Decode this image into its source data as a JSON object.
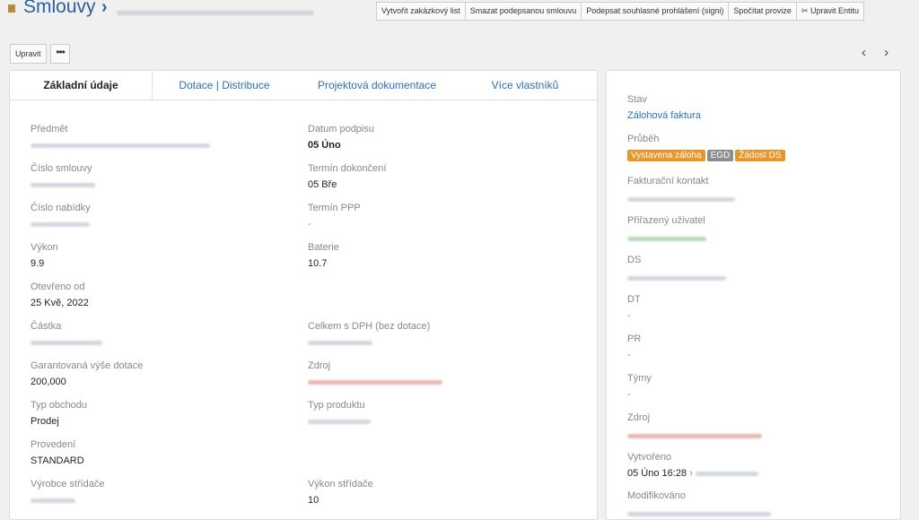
{
  "header": {
    "title": "Smlouvy",
    "chevron": "›",
    "actions": [
      "Vytvořit zakázkový list",
      "Smazat podepsanou smlouvu",
      "Podepsat souhlasné prohlášení (signi)",
      "Spočítat provize",
      "✂ Upravit Entitu"
    ]
  },
  "toolbar": {
    "edit": "Upravit",
    "more": "•••",
    "prev": "‹",
    "next": "›"
  },
  "tabs": [
    "Základní údaje",
    "Dotace | Distribuce",
    "Projektová dokumentace",
    "Více vlastníků"
  ],
  "fields": {
    "predmet": {
      "label": "Předmět"
    },
    "datum_podpisu": {
      "label": "Datum podpisu",
      "value": "05 Úno"
    },
    "cislo_smlouvy": {
      "label": "Číslo smlouvy"
    },
    "termin_dokonceni": {
      "label": "Termín dokončení",
      "value": "05 Bře"
    },
    "cislo_nabidky": {
      "label": "Číslo nabídky"
    },
    "termin_ppp": {
      "label": "Termín PPP",
      "value": "-"
    },
    "vykon": {
      "label": "Výkon",
      "value": "9.9"
    },
    "baterie": {
      "label": "Baterie",
      "value": "10.7"
    },
    "otevreno_od": {
      "label": "Otevřeno od",
      "value": "25 Kvě, 2022"
    },
    "castka": {
      "label": "Částka"
    },
    "celkem_dph": {
      "label": "Celkem s DPH (bez dotace)"
    },
    "garantovana": {
      "label": "Garantovaná výše dotace",
      "value": "200,000"
    },
    "zdroj": {
      "label": "Zdroj"
    },
    "typ_obchodu": {
      "label": "Typ obchodu",
      "value": "Prodej"
    },
    "typ_produktu": {
      "label": "Typ produktu"
    },
    "provedeni": {
      "label": "Provedení",
      "value": "STANDARD"
    },
    "vyrobce_stridace": {
      "label": "Výrobce střídače"
    },
    "vykon_stridace": {
      "label": "Výkon střídače",
      "value": "10"
    }
  },
  "side": {
    "stav": {
      "label": "Stav",
      "value": "Zálohová faktura"
    },
    "prubeh": {
      "label": "Průběh",
      "badges": [
        "Vystavena záloha",
        "EGD",
        "Žádost DS"
      ]
    },
    "fakturacni": {
      "label": "Fakturační kontakt"
    },
    "prirazeny": {
      "label": "Přiřazený uživatel"
    },
    "ds": {
      "label": "DS"
    },
    "dt": {
      "label": "DT",
      "value": "-"
    },
    "pr": {
      "label": "PR",
      "value": "-"
    },
    "tymy": {
      "label": "Týmy",
      "value": "-"
    },
    "zdroj": {
      "label": "Zdroj"
    },
    "vytvoreno": {
      "label": "Vytvořeno",
      "value": "05 Úno 16:28",
      "sep": "›"
    },
    "modifikovano": {
      "label": "Modifikováno"
    }
  }
}
